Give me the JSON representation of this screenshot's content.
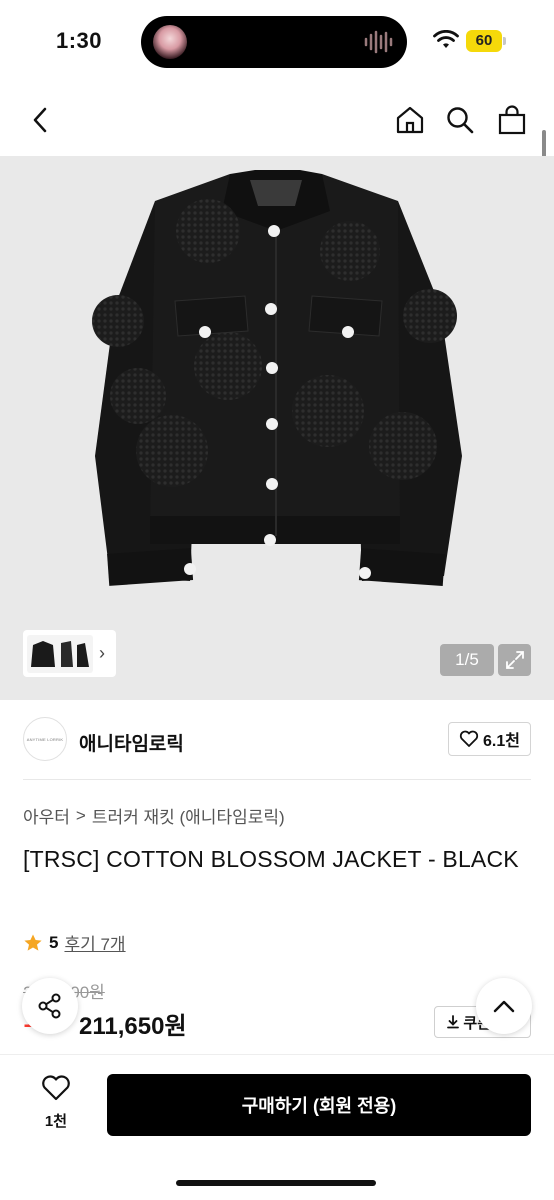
{
  "status": {
    "time": "1:30",
    "battery": "60"
  },
  "gallery": {
    "counter": "1/5"
  },
  "brand": {
    "name": "애니타임로릭",
    "logo_text": "ANYTIME LORRIK",
    "likes": "6.1천"
  },
  "breadcrumb": {
    "category": "아우터",
    "separator": ">",
    "sub": "트러커 재킷 (애니타임로릭)"
  },
  "product": {
    "title": "[TRSC] COTTON BLOSSOM JACKET - BLACK",
    "rating": "5",
    "reviews": "후기 7개",
    "original_price": "2_ _,_00원",
    "discount": "1_%",
    "price": "211,650원",
    "coupon_label": "쿠폰받기"
  },
  "bottom": {
    "wish_count": "1천",
    "buy_label": "구매하기 (회원 전용)"
  },
  "colors": {
    "accent": "#000000",
    "discount": "#ff3b30",
    "star": "#f5a623",
    "battery": "#f5d90a"
  }
}
